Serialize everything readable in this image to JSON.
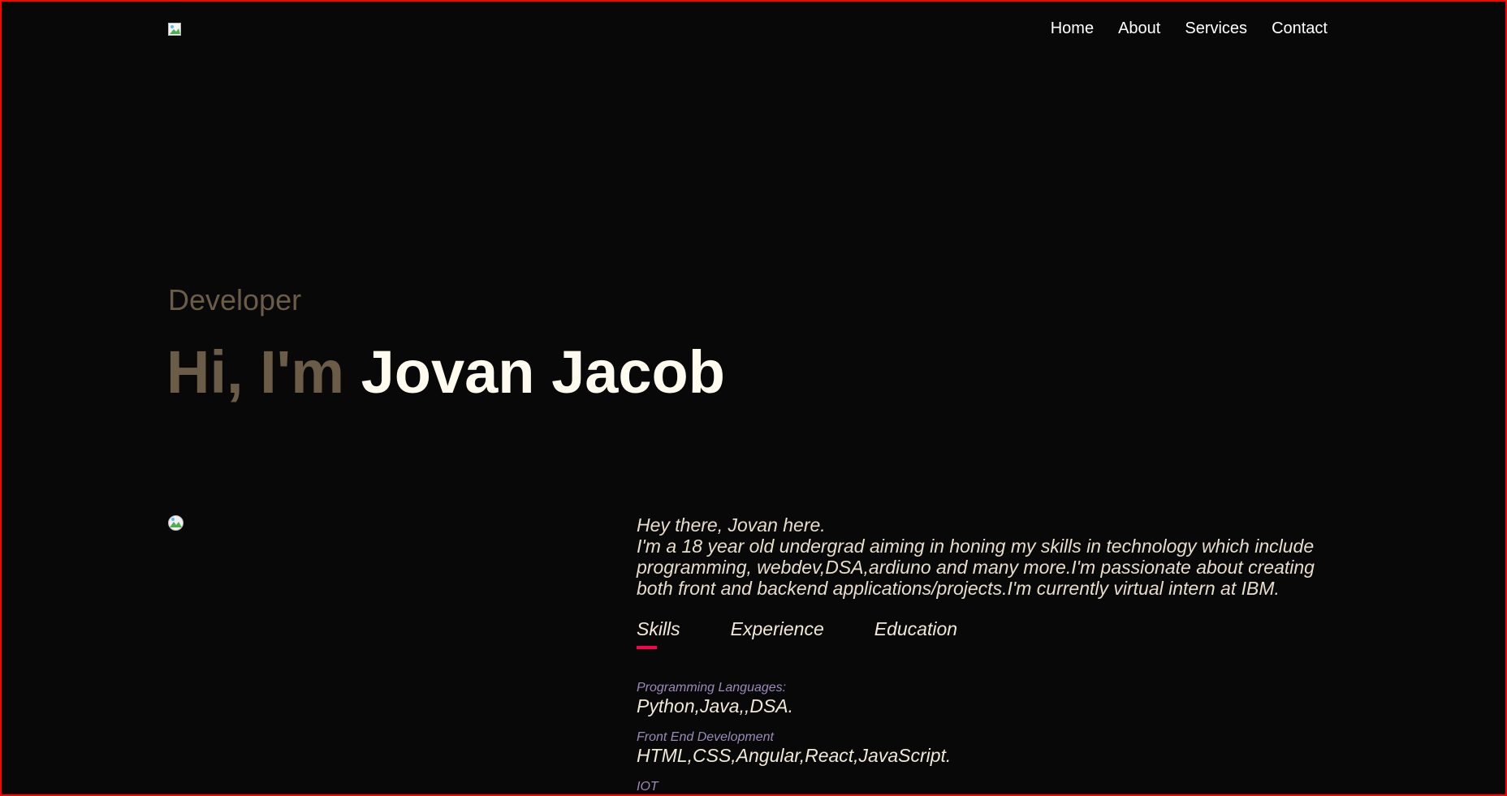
{
  "nav": {
    "links": [
      "Home",
      "About",
      "Services",
      "Contact"
    ]
  },
  "hero": {
    "role": "Developer",
    "greeting": "Hi, I'm ",
    "name": "Jovan Jacob"
  },
  "about": {
    "line1": "Hey there, Jovan here.",
    "line2": "I'm a 18 year old undergrad aiming in honing my skills in technology which include programming, webdev,DSA,ardiuno and many more.I'm passionate about creating both front and backend applications/projects.I'm currently virtual intern at IBM.",
    "tabs": [
      "Skills",
      "Experience",
      "Education"
    ],
    "active_tab": "Skills",
    "skills": [
      {
        "category": "Programming Languages:",
        "value": "Python,Java,,DSA."
      },
      {
        "category": "Front End Development",
        "value": "HTML,CSS,Angular,React,JavaScript."
      },
      {
        "category": "IOT",
        "value": ""
      }
    ]
  },
  "colors": {
    "background": "#080808",
    "accent": "#ff004f",
    "muted_gold": "#6a5c46",
    "border": "#ff0000"
  }
}
